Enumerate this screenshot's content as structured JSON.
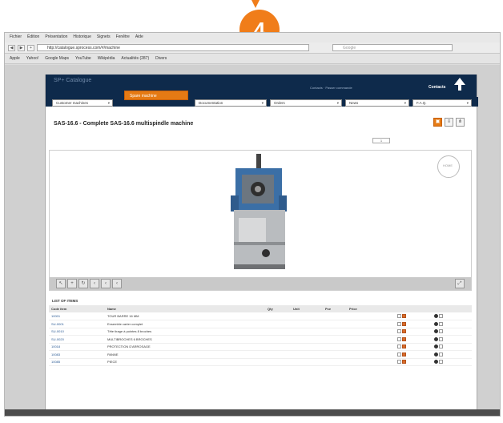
{
  "step": {
    "number": "4"
  },
  "browser": {
    "menu": [
      "Fichier",
      "Édition",
      "Présentation",
      "Historique",
      "Signets",
      "Fenêtre",
      "Aide"
    ],
    "address": "http://catalogue.sprocess.com/#/machine",
    "search_placeholder": "Google",
    "bookmarks": [
      "Apple",
      "Yahoo!",
      "Google Maps",
      "YouTube",
      "Wikipédia",
      "Actualités (287)",
      "Divers"
    ]
  },
  "app": {
    "logo": "SP+ Catalogue",
    "header_links": "Contacts · Passer commande",
    "contact_label": "Contacts",
    "nav": [
      {
        "label": "Customer machines"
      },
      {
        "label": "Documentation"
      },
      {
        "label": "Orders"
      },
      {
        "label": "News"
      },
      {
        "label": "F.A.Q."
      }
    ],
    "spare_parts_popup": "Spare machine",
    "title": "SAS-16.6 - Complete SAS-16.6 multispindle machine",
    "tools": [
      "3D",
      "list",
      "tree"
    ],
    "pager": "1",
    "compass_label": "HOME",
    "toolbar_buttons": [
      "pointer",
      "zoom",
      "rotate",
      "pan-left",
      "pan",
      "pan-right"
    ],
    "parts_list": {
      "title": "LIST OF ITEMS",
      "columns": [
        "Code item",
        "Name",
        "Qty",
        "Unit",
        "Pce",
        "Price"
      ],
      "rows": [
        {
          "code": "10001",
          "name": "TOUR BARRE 16 MM"
        },
        {
          "code": "SU-0001",
          "name": "Ensemble carter complet"
        },
        {
          "code": "SU-0010",
          "name": "Tête tirage à pointes 8 broches"
        },
        {
          "code": "SU-0020",
          "name": "MULTIBROCHES 6 BROCHES"
        },
        {
          "code": "10018",
          "name": "PROTECTION D'ARROSAGE"
        },
        {
          "code": "10083",
          "name": "PANNE"
        },
        {
          "code": "10085",
          "name": "PIECE"
        }
      ]
    }
  },
  "colors": {
    "accent": "#f07d1a",
    "header_bg": "#0e2a4b",
    "link": "#2a5a94"
  }
}
